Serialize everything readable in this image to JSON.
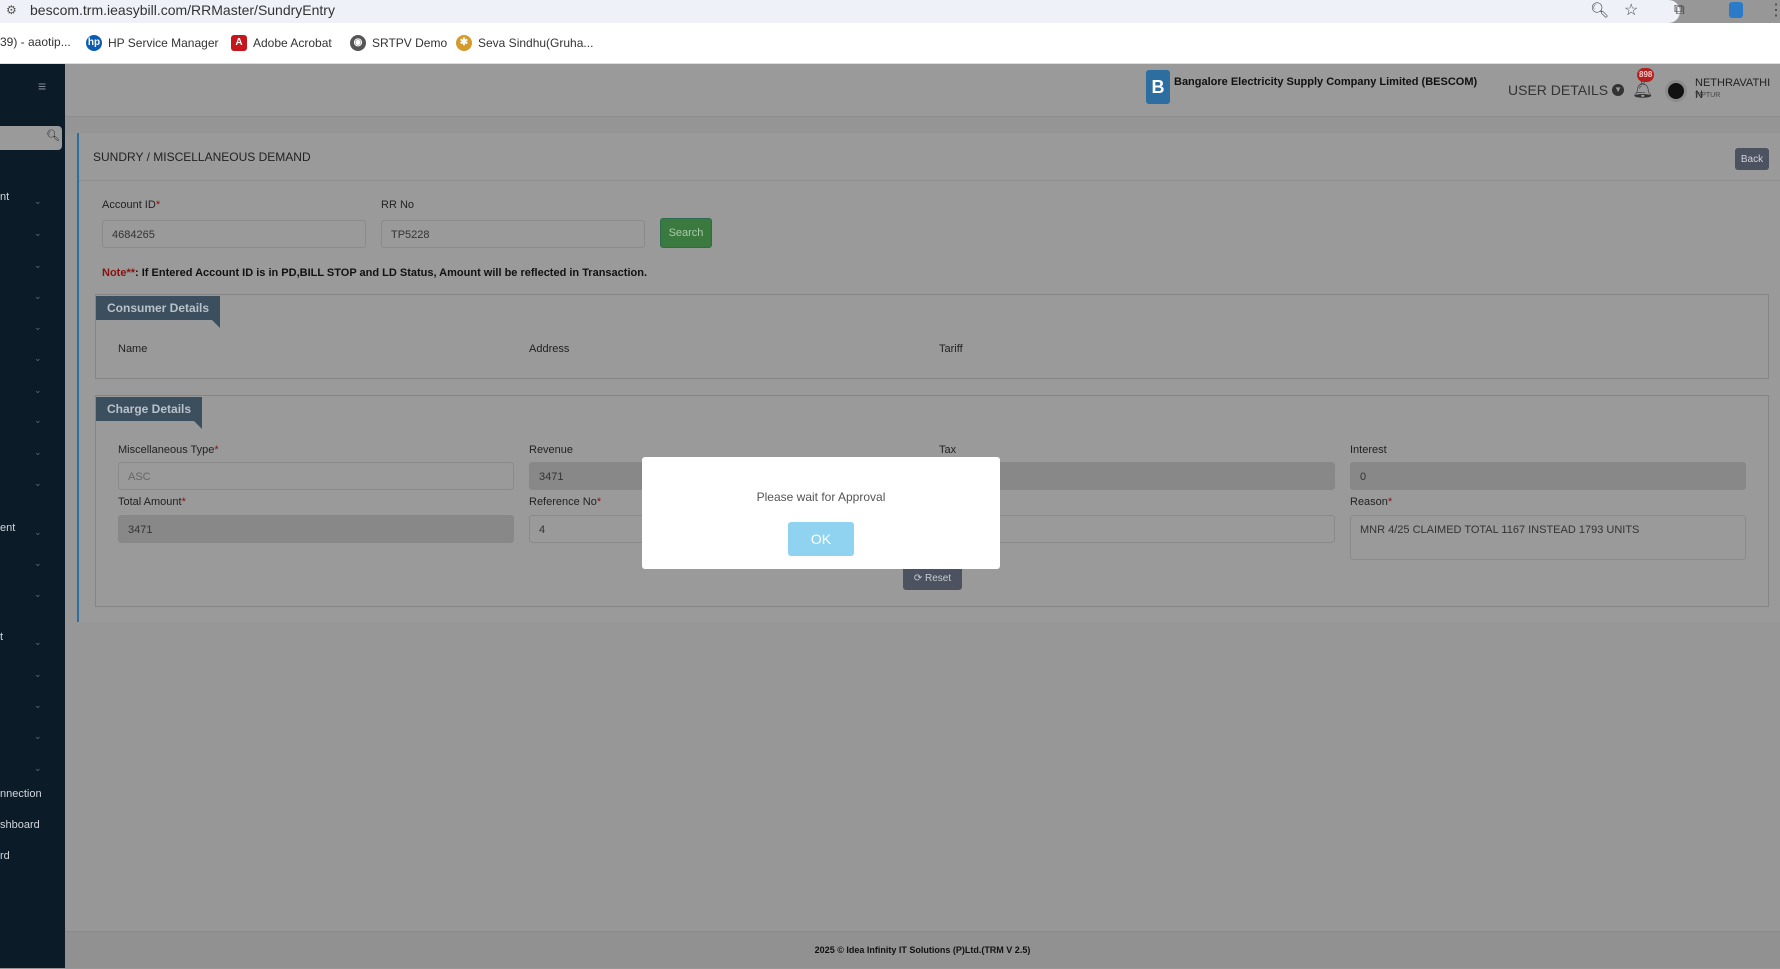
{
  "browser": {
    "url": "bescom.trm.ieasybill.com/RRMaster/SundryEntry",
    "bookmarks": [
      {
        "label": "39) - aaotip...",
        "icon": "bookmark-icon"
      },
      {
        "label": "HP Service Manager",
        "icon": "hp-icon"
      },
      {
        "label": "Adobe Acrobat",
        "icon": "acrobat-icon"
      },
      {
        "label": "SRTPV Demo",
        "icon": "globe-icon"
      },
      {
        "label": "Seva Sindhu(Gruha...",
        "icon": "emblem-icon"
      }
    ]
  },
  "sidebar": {
    "labels": [
      "nt",
      "ent",
      "t",
      "nnection",
      "shboard",
      "rd"
    ]
  },
  "header": {
    "company": "Bangalore Electricity Supply Company Limited (BESCOM)",
    "user_details": "USER DETAILS",
    "notif_count": "898",
    "user_name": "NETHRAVATHI N",
    "user_location": "TIPTUR"
  },
  "page": {
    "title": "SUNDRY / MISCELLANEOUS DEMAND",
    "back": "Back",
    "account_label": "Account ID",
    "account_value": "4684265",
    "rr_label": "RR No",
    "rr_value": "TP5228",
    "search": "Search",
    "note_prefix": "Note**",
    "note_text": ": If Entered Account ID is in PD,BILL STOP and LD Status, Amount will be reflected in Transaction.",
    "consumer": {
      "title": "Consumer Details",
      "name": "Name",
      "address": "Address",
      "tariff": "Tariff"
    },
    "charge": {
      "title": "Charge Details",
      "misc_label": "Miscellaneous Type",
      "misc_value": "ASC",
      "revenue_label": "Revenue",
      "revenue_value": "3471",
      "tax_label": "Tax",
      "tax_value": "",
      "interest_label": "Interest",
      "interest_value": "0",
      "total_label": "Total Amount",
      "total_value": "3471",
      "ref_label": "Reference No",
      "ref_value": "4",
      "reason_label": "Reason",
      "reason_value": "MNR 4/25 CLAIMED TOTAL 1167 INSTEAD 1793 UNITS",
      "reset": "Reset"
    },
    "required": "*"
  },
  "modal": {
    "message": "Please wait for Approval",
    "ok": "OK"
  },
  "footer": "2025 © Idea Infinity IT Solutions (P)Ltd.(TRM V 2.5)"
}
